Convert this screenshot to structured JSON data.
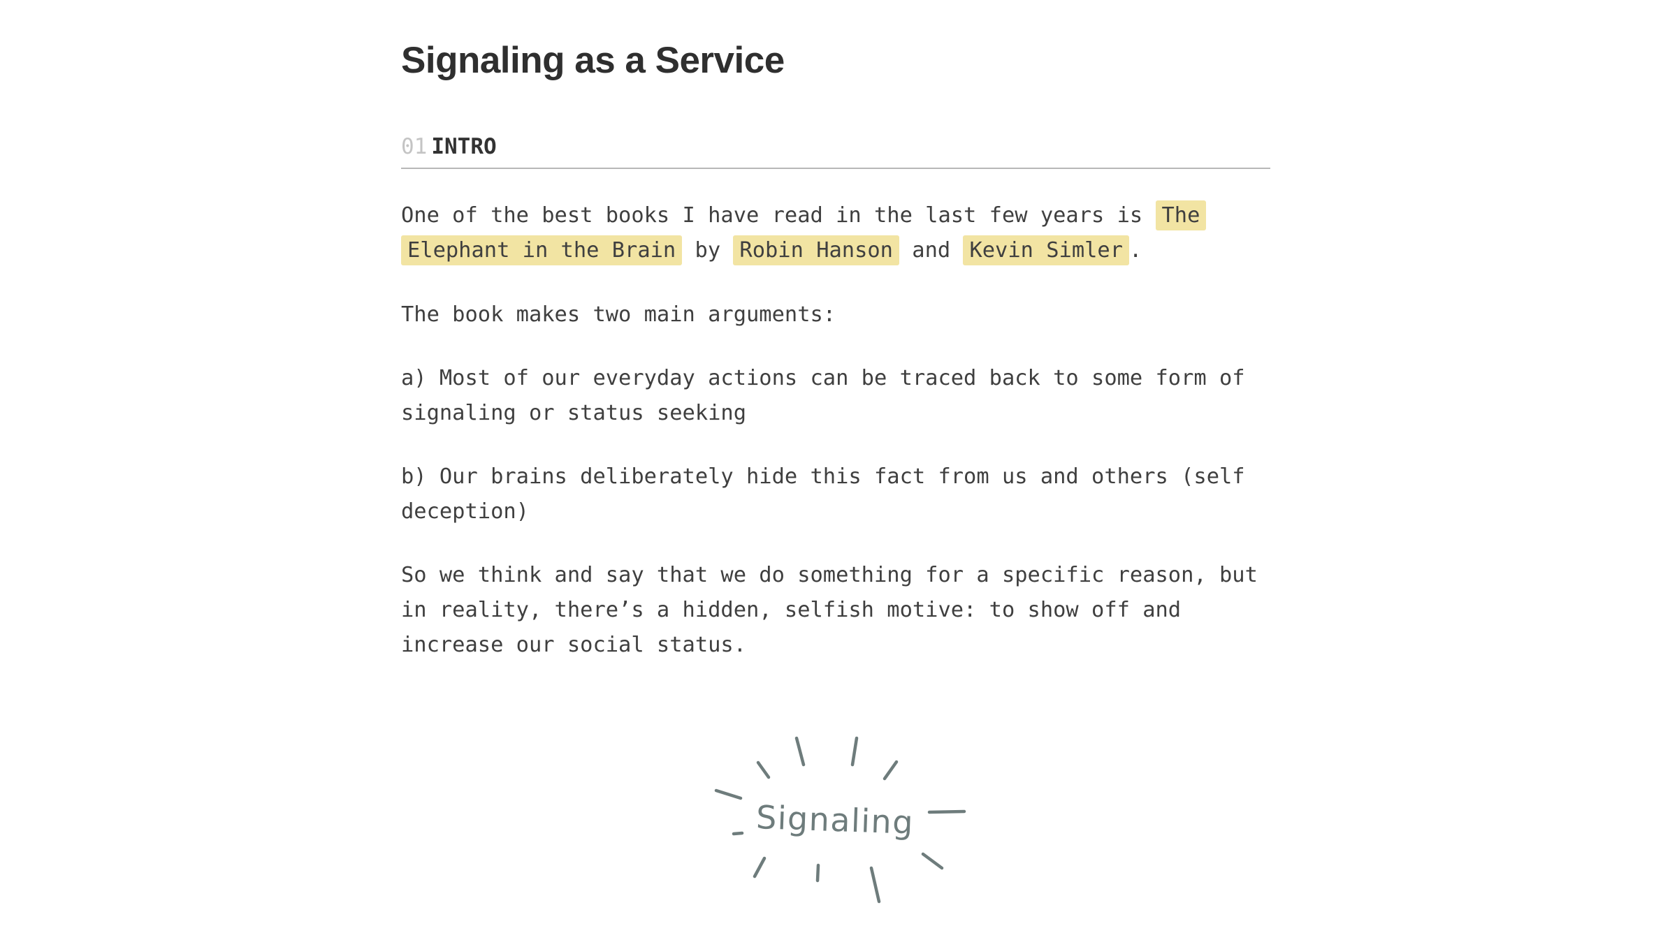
{
  "article": {
    "title": "Signaling as a Service",
    "section": {
      "number": "01",
      "label": "INTRO"
    },
    "intro_paragraph": {
      "line1_text": "One of the best books I have read in the last few years is ",
      "line1_highlight": "The",
      "line2_highlight_book": "Elephant in the Brain",
      "line2_by": " by ",
      "author1": "Robin Hanson",
      "line2_and": " and ",
      "author2": "Kevin Simler",
      "line2_end": "."
    },
    "arguments_intro": "The book makes two main arguments:",
    "argument_a": {
      "line1": "a) Most of our everyday actions can be traced back to some form of",
      "line2": "signaling or status seeking"
    },
    "argument_b": {
      "line1": "b) Our brains deliberately hide this fact from us and others (self",
      "line2": "deception)"
    },
    "conclusion": {
      "line1": "So we think and say that we do something for a specific reason, but",
      "line2": "in reality, there’s a hidden, selfish motive: to show off and",
      "line3": "increase our social status."
    },
    "illustration": {
      "handwritten_word": "Signaling",
      "stroke_color": "#6e7c7c"
    },
    "colors": {
      "highlight": "#f2e4a3",
      "text": "#3f3f3f",
      "rule": "#b8b8b8"
    }
  }
}
